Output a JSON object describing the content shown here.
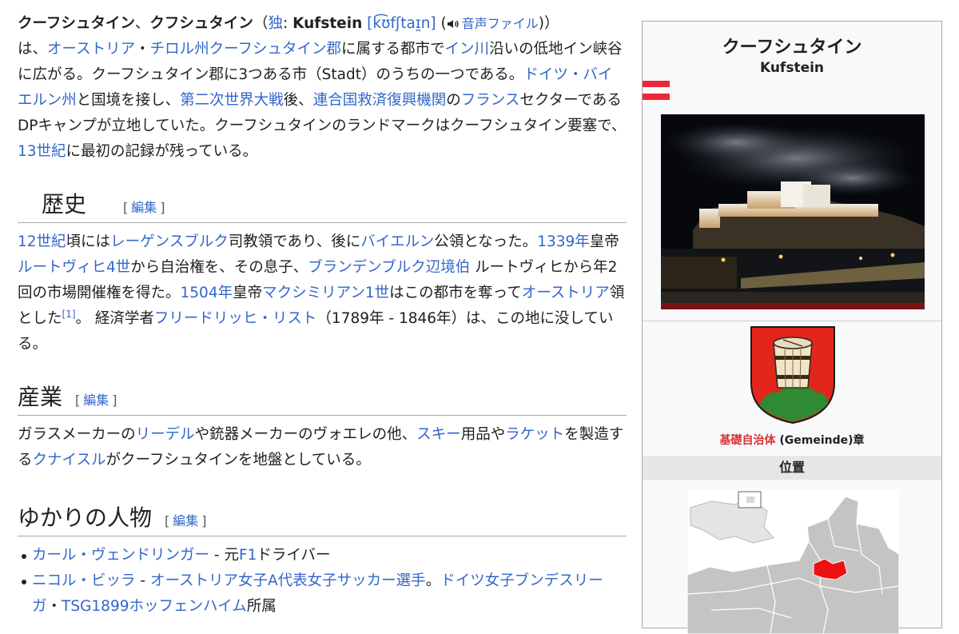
{
  "intro": {
    "title_bold1": "クーフシュタイン",
    "sep1": "、",
    "title_bold2": "クフシュタイン",
    "paren_open": "（",
    "lang": "独",
    "colon": ": ",
    "de_name": "Kufstein",
    "ipa": "[k͡ʊfʃtaɪ̯n]",
    "audio_open": " (",
    "audio_label": "音声ファイル",
    "audio_close": ")",
    "paren_close": "）",
    "s1": "は、",
    "l_austria": "オーストリア",
    "s2": "・",
    "l_tyrol": "チロル州",
    "l_district": "クーフシュタイン郡",
    "s3": "に属する都市で",
    "l_inn": "イン川",
    "s4": "沿いの低地イン峡谷に広がる。クーフシュタイン郡に3つある市（Stadt）のうちの一つである。",
    "l_bavaria": "ドイツ・バイエルン州",
    "s5": "と国境を接し、",
    "l_ww2": "第二次世界大戦",
    "s6": "後、",
    "l_unrra": "連合国救済復興機関",
    "s7": "の",
    "l_france": "フランス",
    "s8": "セクターであるDPキャンプが立地していた。クーフシュタインのランドマークはクーフシュタイン要塞で、",
    "l_13c": "13世紀",
    "s9": "に最初の記録が残っている。"
  },
  "history": {
    "heading": "歴史",
    "edit_open": "[",
    "edit_label": "編集",
    "edit_close": "]",
    "l_12c": "12世紀",
    "s1": "頃には",
    "l_regensburg": "レーゲンスブルク",
    "s2": "司教領であり、後に",
    "l_bayern": "バイエルン",
    "s3": "公領となった。",
    "l_1339": "1339年",
    "s4": "皇帝",
    "l_ludwig": "ルートヴィヒ4世",
    "s5": "から自治権を、その息子、",
    "l_brandenburg": "ブランデンブルク辺境伯",
    "s6": " ルートヴィヒから年2回の市場開催権を得た。",
    "l_1504": "1504年",
    "s7": "皇帝",
    "l_max": "マクシミリアン1世",
    "s8": "はこの都市を奪って",
    "l_austria": "オーストリア",
    "s9": "領とした",
    "ref": "[1]",
    "s10": "。 経済学者",
    "l_list": "フリードリッヒ・リスト",
    "s11": "（1789年 - 1846年）は、この地に没している。"
  },
  "industry": {
    "heading": "産業",
    "edit_open": "[",
    "edit_label": "編集",
    "edit_close": "]",
    "s1": "ガラスメーカーの",
    "l_riedel": "リーデル",
    "s2": "や銃器メーカーのヴォエレの他、",
    "l_ski": "スキー",
    "s3": "用品や",
    "l_racket": "ラケット",
    "s4": "を製造する",
    "l_kneissl": "クナイスル",
    "s5": "がクーフシュタインを地盤としている。"
  },
  "people": {
    "heading": "ゆかりの人物",
    "edit_open": "[",
    "edit_label": "編集",
    "edit_close": "]",
    "items": [
      {
        "link": "カール・ヴェンドリンガー",
        "t1": " - 元",
        "link2": "F1",
        "t2": "ドライバー"
      },
      {
        "link": "ニコル・ビッラ",
        "t1": " - ",
        "link2": "オーストリア女子A代表女子サッカー選手",
        "t2": "。",
        "link3": "ドイツ女子ブンデスリーガ",
        "t3": "・",
        "link4": "TSG1899ホッフェンハイム",
        "t4": "所属"
      }
    ]
  },
  "infobox": {
    "title": "クーフシュタイン",
    "subtitle": "Kufstein",
    "coa_caption_link": "基礎自治体",
    "coa_caption_text": " (Gemeinde)章",
    "location_header": "位置",
    "colors": {
      "flag_red": "#ed2939",
      "coa_red": "#e2261b",
      "coa_green": "#2f8a33",
      "map_highlight": "#ee1111"
    }
  }
}
